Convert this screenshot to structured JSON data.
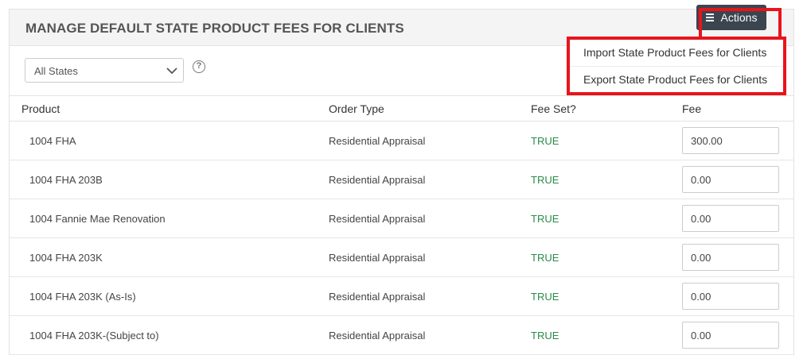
{
  "header": {
    "title": "MANAGE DEFAULT STATE PRODUCT FEES FOR CLIENTS",
    "actions_label": "Actions"
  },
  "actions_menu": {
    "items": [
      {
        "label": "Import State Product Fees for Clients"
      },
      {
        "label": "Export State Product Fees for Clients"
      }
    ]
  },
  "filter": {
    "state_selected": "All States",
    "help_glyph": "?"
  },
  "table": {
    "headers": {
      "product": "Product",
      "order_type": "Order Type",
      "fee_set": "Fee Set?",
      "fee": "Fee"
    },
    "rows": [
      {
        "product": "1004 FHA",
        "order_type": "Residential Appraisal",
        "fee_set": "TRUE",
        "fee": "300.00"
      },
      {
        "product": "1004 FHA 203B",
        "order_type": "Residential Appraisal",
        "fee_set": "TRUE",
        "fee": "0.00"
      },
      {
        "product": "1004 Fannie Mae Renovation",
        "order_type": "Residential Appraisal",
        "fee_set": "TRUE",
        "fee": "0.00"
      },
      {
        "product": "1004 FHA 203K",
        "order_type": "Residential Appraisal",
        "fee_set": "TRUE",
        "fee": "0.00"
      },
      {
        "product": "1004 FHA 203K (As-Is)",
        "order_type": "Residential Appraisal",
        "fee_set": "TRUE",
        "fee": "0.00"
      },
      {
        "product": "1004 FHA 203K-(Subject to)",
        "order_type": "Residential Appraisal",
        "fee_set": "TRUE",
        "fee": "0.00"
      }
    ]
  },
  "colors": {
    "accent_dark": "#3b4550",
    "highlight": "#e8141c",
    "true_status": "#2a8a4a"
  }
}
